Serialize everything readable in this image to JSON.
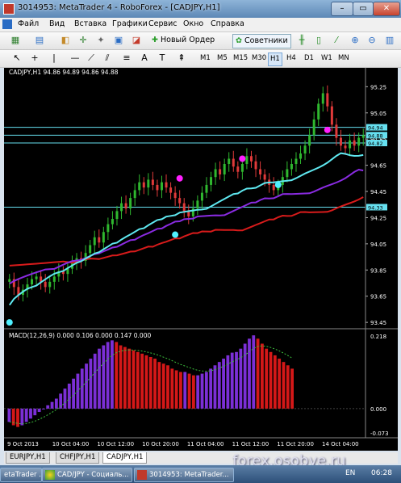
{
  "window": {
    "title": "3014953: MetaTrader 4 - RoboForex - [CADJPY,H1]",
    "min": "–",
    "max": "▭",
    "close": "✕"
  },
  "menu": [
    "Файл",
    "Вид",
    "Вставка",
    "Графики",
    "Сервис",
    "Окно",
    "Справка"
  ],
  "toolbar": {
    "new_order": "Новый Ордер",
    "experts": "Советники"
  },
  "timeframes": [
    "M1",
    "M5",
    "M15",
    "M30",
    "H1",
    "H4",
    "D1",
    "W1",
    "MN"
  ],
  "active_timeframe": "H1",
  "chart_header": "CADJPY,H1  94.86 94.89 94.86 94.88",
  "macd_header": "MACD(12,26,9) 0.000 0.106 0.000 0.147 0.000",
  "tabs": [
    "EURJPY,H1",
    "CHFJPY,H1",
    "CADJPY,H1"
  ],
  "active_tab": "CADJPY,H1",
  "watermark": "forex.osobye.ru",
  "taskbar": {
    "items": [
      "etaTrader ...",
      "CAD/JPY - Социаль...",
      "3014953: MetaTrader..."
    ],
    "lang": "EN",
    "clock": "06:28"
  },
  "colors": {
    "bull": "#2fb82f",
    "bear": "#e03a3a",
    "fast_ma": "#5fe8f0",
    "mid_ma": "#8a2be2",
    "slow_ma": "#d81b1b",
    "macd_blue": "#7b2fd6",
    "macd_red": "#d41818",
    "level": "#66e0f0",
    "dot_magenta": "#ff1fff",
    "dot_cyan": "#4ff0ff"
  },
  "chart_data": {
    "type": "candlestick",
    "symbol": "CADJPY,H1",
    "price_axis": {
      "ticks": [
        95.25,
        95.05,
        94.85,
        94.65,
        94.45,
        94.25,
        94.05,
        93.85,
        93.65,
        93.45
      ],
      "ylim": [
        93.42,
        95.32
      ]
    },
    "time_axis": {
      "labels": [
        "9 Oct 2013",
        "10 Oct 04:00",
        "10 Oct 12:00",
        "10 Oct 20:00",
        "11 Oct 04:00",
        "11 Oct 12:00",
        "11 Oct 20:00",
        "14 Oct 04:00"
      ]
    },
    "levels": [
      {
        "value": 94.94,
        "label": "94.94"
      },
      {
        "value": 94.88,
        "label": "94.88"
      },
      {
        "value": 94.82,
        "label": "94.82"
      },
      {
        "value": 94.33,
        "label": "94.33"
      }
    ],
    "close": [
      93.78,
      93.72,
      93.66,
      93.7,
      93.74,
      93.78,
      93.8,
      93.76,
      93.72,
      93.76,
      93.8,
      93.84,
      93.82,
      93.86,
      93.9,
      93.94,
      93.92,
      93.98,
      94.04,
      94.1,
      94.06,
      94.14,
      94.2,
      94.24,
      94.3,
      94.36,
      94.32,
      94.4,
      94.46,
      94.52,
      94.48,
      94.54,
      94.5,
      94.46,
      94.52,
      94.48,
      94.44,
      94.4,
      94.36,
      94.3,
      94.26,
      94.32,
      94.38,
      94.44,
      94.5,
      94.56,
      94.62,
      94.58,
      94.66,
      94.7,
      94.64,
      94.6,
      94.66,
      94.72,
      94.68,
      94.62,
      94.58,
      94.54,
      94.5,
      94.46,
      94.5,
      94.56,
      94.62,
      94.66,
      94.7,
      94.74,
      94.8,
      94.88,
      95.0,
      95.12,
      95.2,
      95.1,
      94.96,
      94.86,
      94.8,
      94.78,
      94.84,
      94.8,
      94.86,
      94.88
    ],
    "ma_fast": {
      "start": 93.55,
      "end": 94.72
    },
    "ma_mid": {
      "start": 93.74,
      "end": 94.53
    },
    "ma_slow": {
      "start": 93.9,
      "end": 94.33
    },
    "macd_axis": {
      "ticks": [
        0.218,
        0.0,
        -0.073
      ]
    },
    "macd": [
      -0.04,
      -0.05,
      -0.055,
      -0.05,
      -0.04,
      -0.03,
      -0.02,
      -0.01,
      0.0,
      0.01,
      0.02,
      0.03,
      0.045,
      0.06,
      0.075,
      0.09,
      0.105,
      0.12,
      0.135,
      0.15,
      0.165,
      0.18,
      0.19,
      0.2,
      0.205,
      0.2,
      0.19,
      0.185,
      0.18,
      0.175,
      0.17,
      0.165,
      0.16,
      0.155,
      0.15,
      0.14,
      0.135,
      0.13,
      0.12,
      0.115,
      0.11,
      0.11,
      0.105,
      0.1,
      0.1,
      0.105,
      0.11,
      0.12,
      0.13,
      0.14,
      0.15,
      0.16,
      0.168,
      0.17,
      0.18,
      0.195,
      0.21,
      0.22,
      0.21,
      0.195,
      0.18,
      0.17,
      0.16,
      0.15,
      0.14,
      0.13,
      0.12
    ]
  }
}
